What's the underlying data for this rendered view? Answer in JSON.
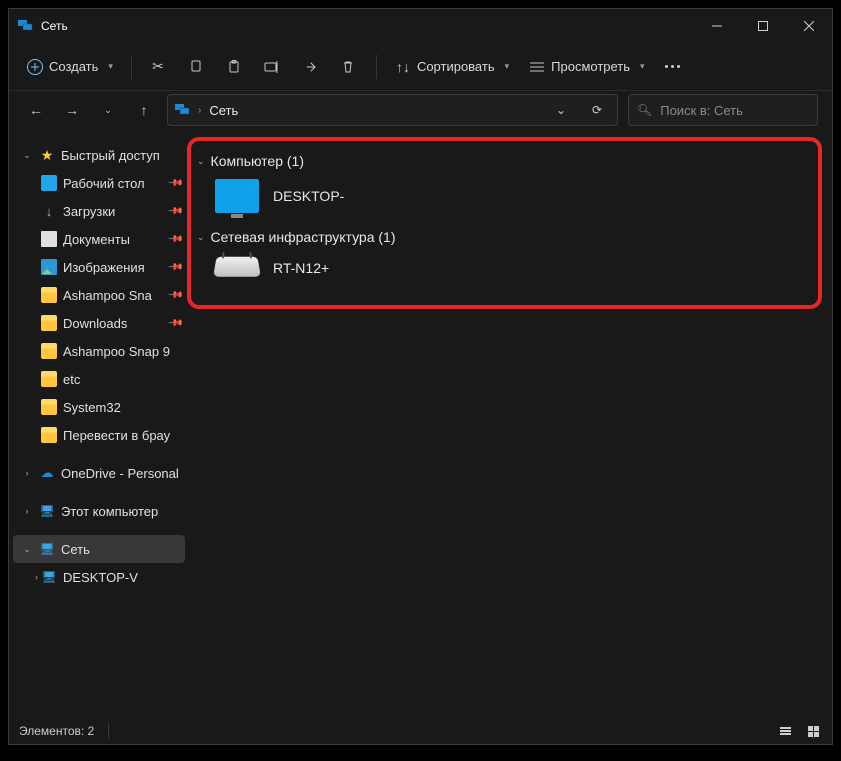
{
  "title": "Сеть",
  "toolbar": {
    "new_label": "Создать",
    "sort_label": "Сортировать",
    "view_label": "Просмотреть"
  },
  "address": {
    "crumb": "Сеть"
  },
  "search": {
    "placeholder": "Поиск в: Сеть"
  },
  "sidebar": {
    "quick": "Быстрый доступ",
    "desktop": "Рабочий стол",
    "downloads": "Загрузки",
    "documents": "Документы",
    "pictures": "Изображения",
    "f1": "Ashampoo Sna",
    "f2": "Downloads",
    "f3": "Ashampoo Snap 9",
    "f4": "etc",
    "f5": "System32",
    "f6": "Перевести в брау",
    "onedrive": "OneDrive - Personal",
    "thispc": "Этот компьютер",
    "network": "Сеть",
    "net_child": "DESKTOP-V"
  },
  "content": {
    "group1_label": "Компьютер (1)",
    "item1_label": "DESKTOP-",
    "group2_label": "Сетевая инфраструктура (1)",
    "item2_label": "RT-N12+"
  },
  "status": {
    "count_label": "Элементов: 2"
  }
}
